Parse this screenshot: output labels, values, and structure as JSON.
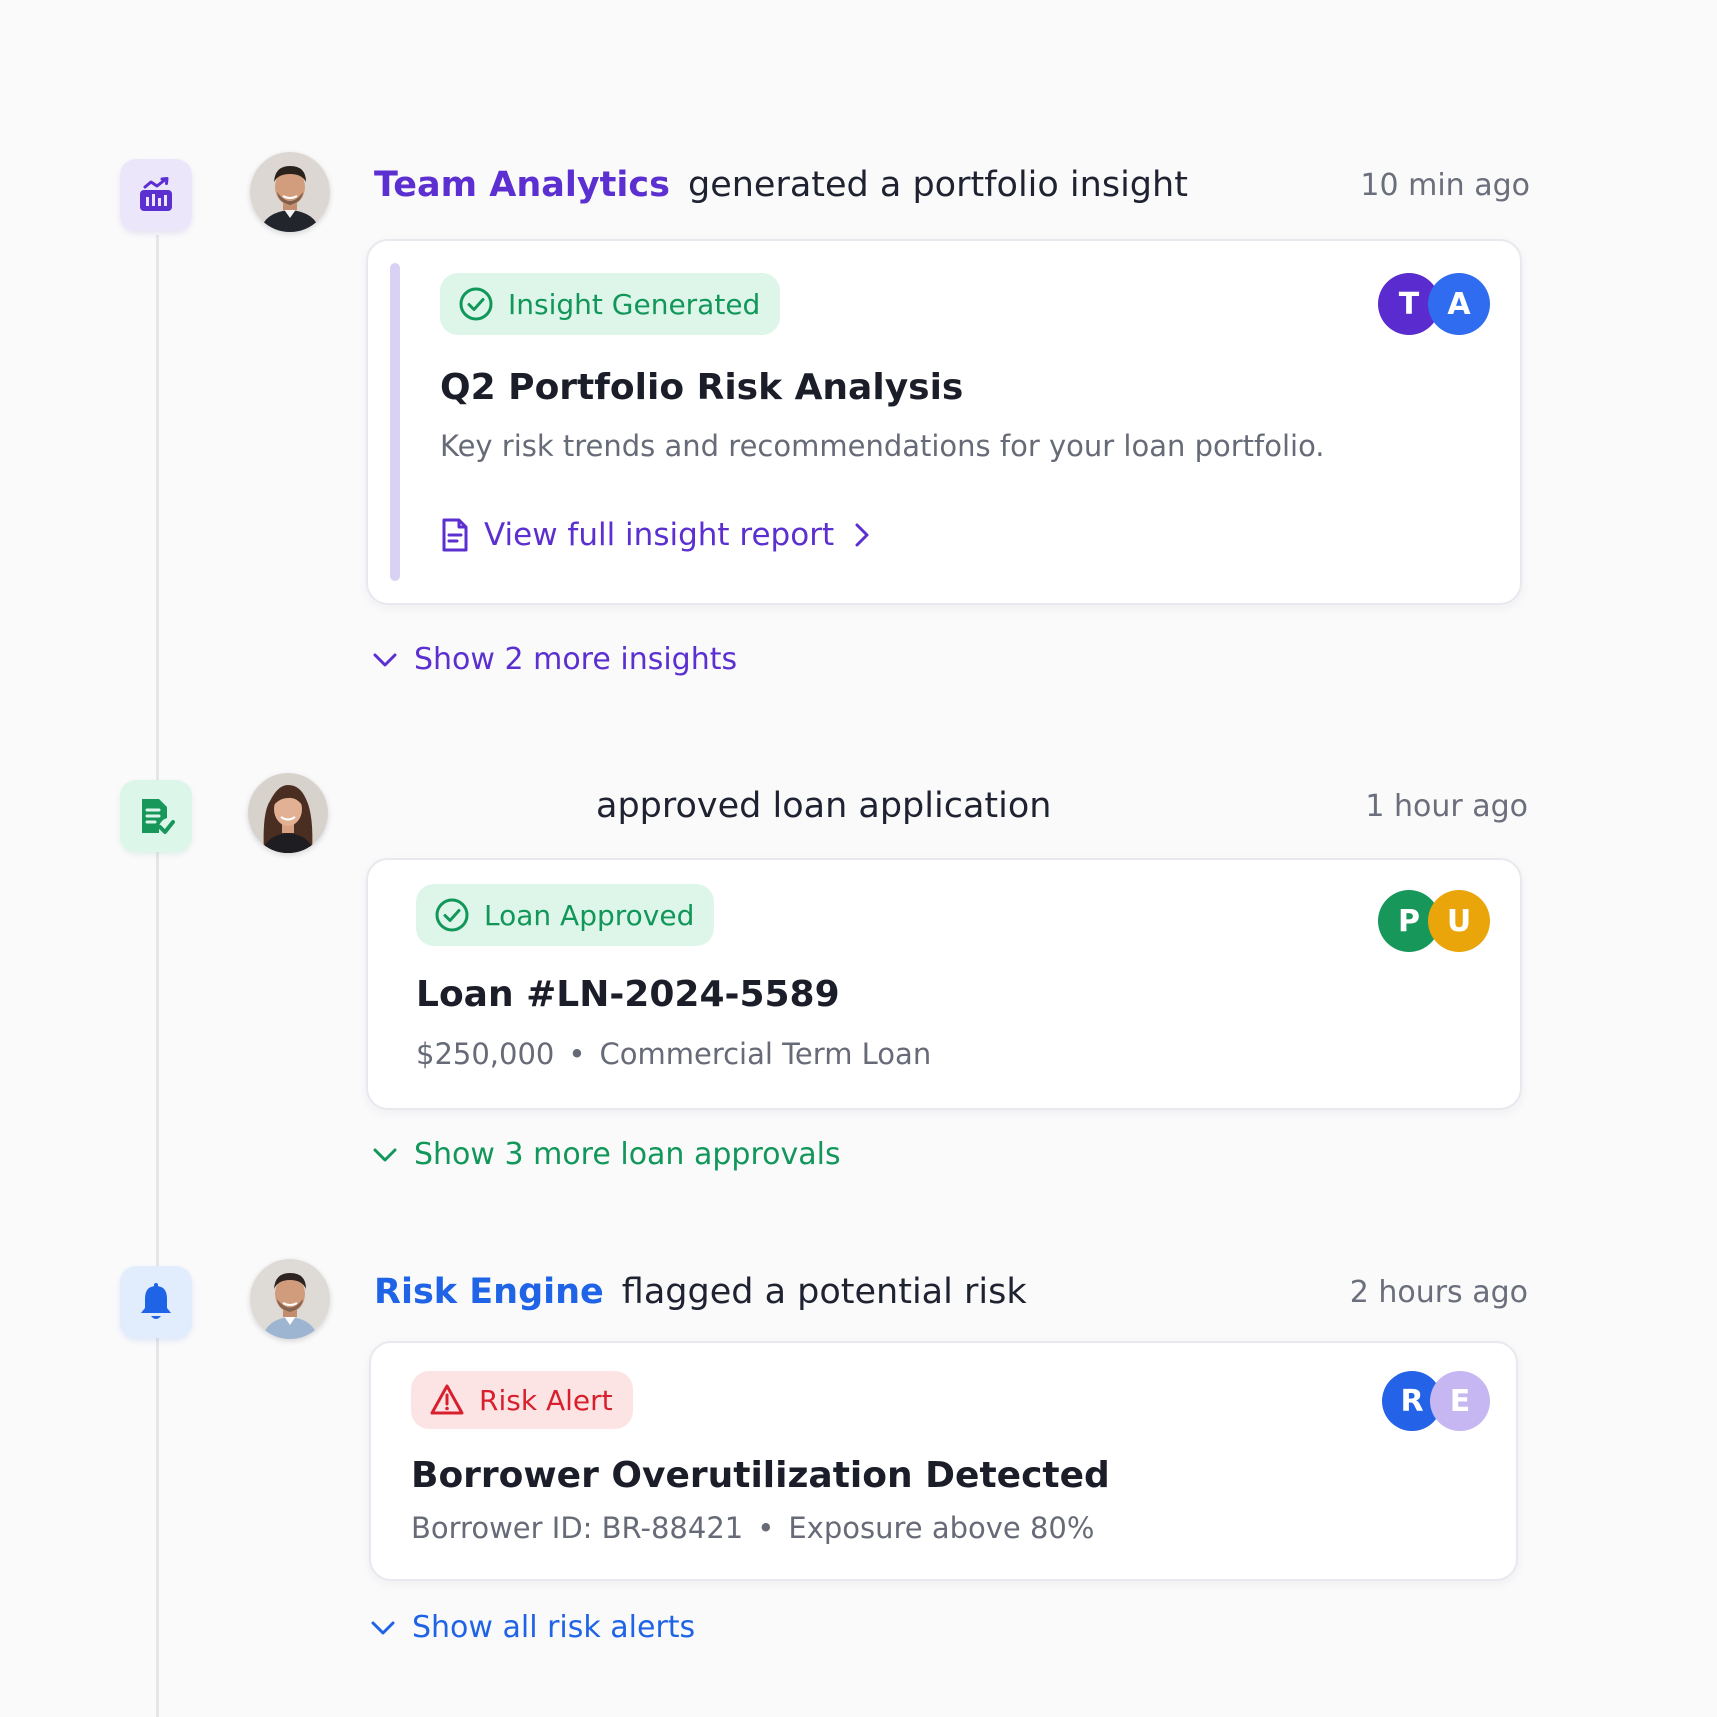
{
  "events": [
    {
      "type_icon": "analytics-chart-icon",
      "actor": "Team Analytics",
      "action": "generated a portfolio insight",
      "time": "10 min ago",
      "badge": "Insight Generated",
      "title": "Q2 Portfolio Risk Analysis",
      "description": "Key risk trends and recommendations for your loan portfolio.",
      "link_label": "View full insight report",
      "participants": [
        "T",
        "A"
      ],
      "show_more": "Show 2 more insights"
    },
    {
      "type_icon": "document-check-icon",
      "actor": "",
      "action": "approved loan application",
      "time": "1 hour ago",
      "badge": "Loan Approved",
      "title": "Loan #LN-2024-5589",
      "amount": "$250,000",
      "separator": "•",
      "loan_type": "Commercial Term Loan",
      "participants": [
        "P",
        "U"
      ],
      "show_more": "Show 3 more loan approvals"
    },
    {
      "type_icon": "bell-icon",
      "actor": "Risk Engine",
      "action": "flagged a potential risk",
      "time": "2 hours ago",
      "badge": "Risk Alert",
      "title": "Borrower Overutilization Detected",
      "borrower_id": "Borrower ID: BR-88421",
      "separator": "•",
      "exposure": "Exposure above 80%",
      "participants": [
        "R",
        "E"
      ],
      "show_more": "Show all risk alerts"
    }
  ],
  "colors": {
    "purple_accent": "#5b2fd0",
    "green_accent": "#12975a",
    "blue_accent": "#1f63e6",
    "red_alert": "#d71f2d",
    "avatar_T": "#5a2ccf",
    "avatar_A": "#2f6cf0",
    "avatar_P": "#17985a",
    "avatar_U": "#eaa50a",
    "avatar_R": "#2462e8",
    "avatar_E": "#c6b6f2"
  }
}
